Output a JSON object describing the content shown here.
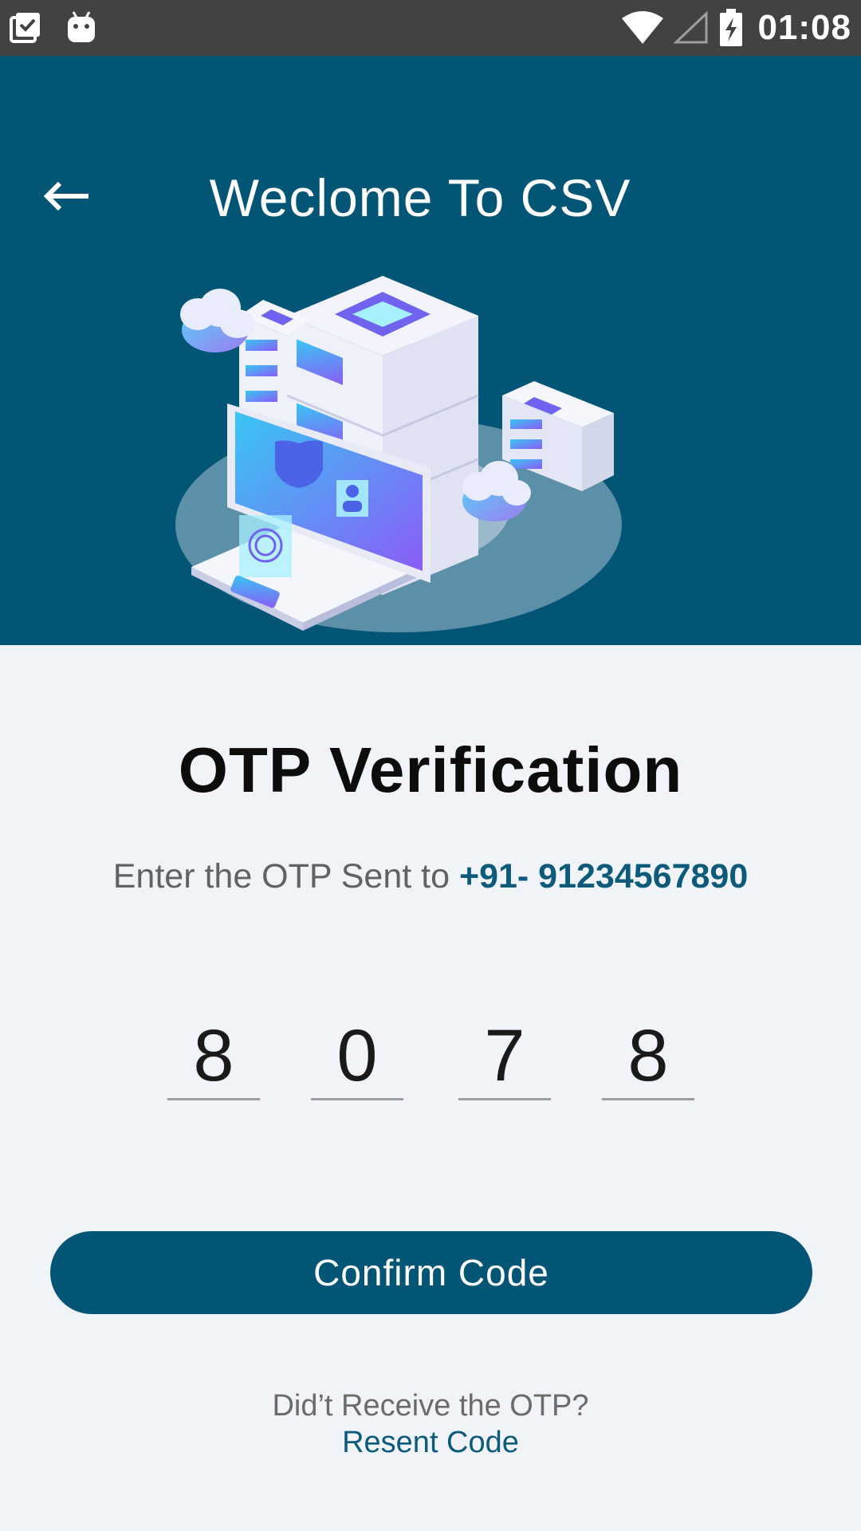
{
  "status_bar": {
    "time": "01:08",
    "icons": [
      "clipboard-check-icon",
      "android-icon",
      "wifi-icon",
      "signal-icon",
      "battery-charging-icon"
    ]
  },
  "header": {
    "title": "Weclome To CSV",
    "back_icon": "arrow-left-icon",
    "background": "#035576"
  },
  "content": {
    "title": "OTP Verification",
    "subtitle_prefix": "Enter the OTP Sent to ",
    "phone": "+91- 91234567890",
    "otp_digits": [
      "8",
      "0",
      "7",
      "8"
    ],
    "confirm_label": "Confirm Code",
    "didnt_receive": "Did’t Receive the OTP?",
    "resend_label": "Resent Code"
  },
  "colors": {
    "primary": "#035576",
    "accent_text": "#0d5a7b",
    "background": "#f0f4f8"
  }
}
